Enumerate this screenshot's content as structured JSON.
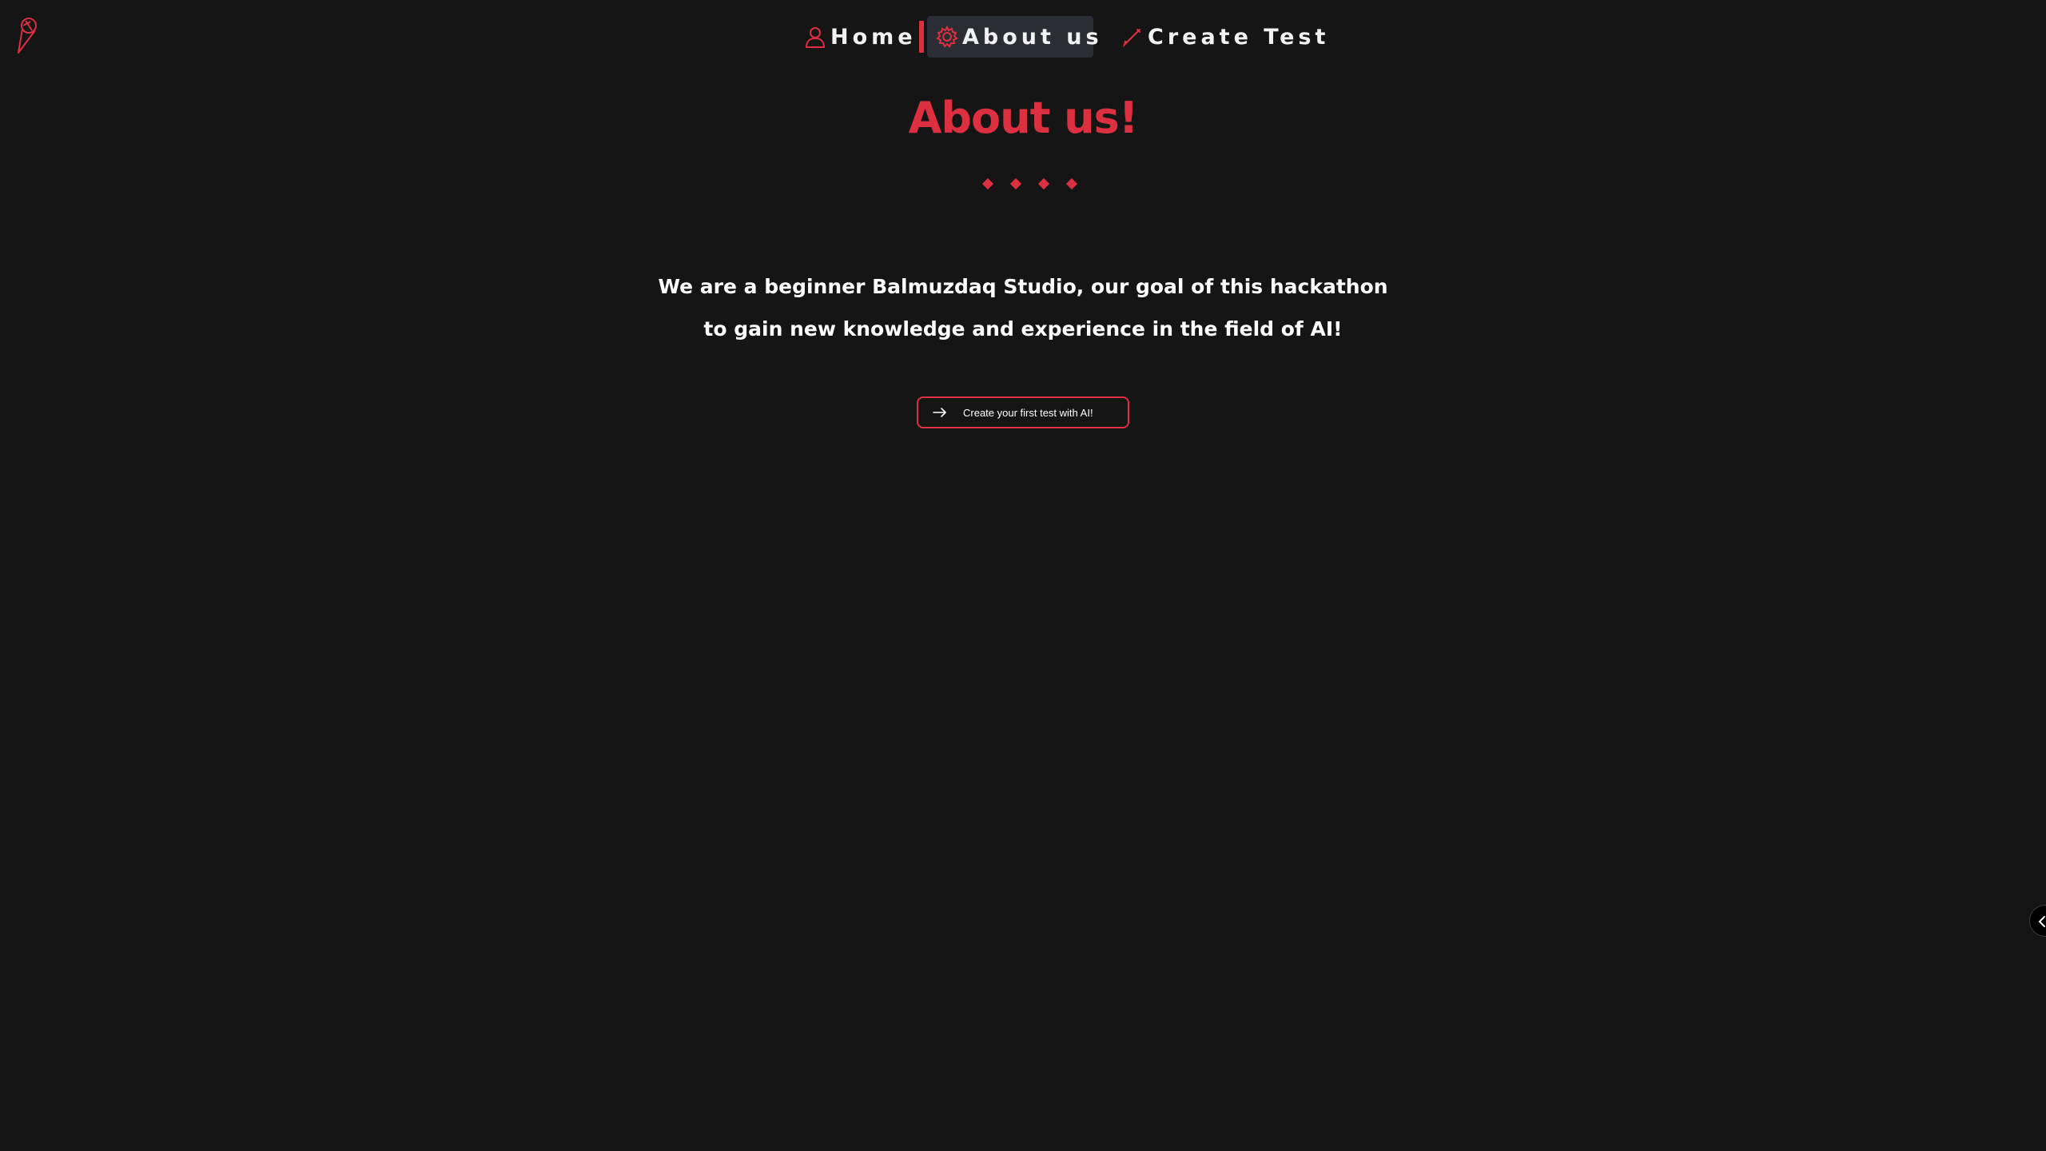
{
  "nav": {
    "items": [
      {
        "label": "Home",
        "icon": "user-icon"
      },
      {
        "label": "About us",
        "icon": "gear-icon",
        "active": true
      },
      {
        "label": "Create Test",
        "icon": "pen-icon"
      }
    ]
  },
  "main": {
    "title": "About us!",
    "intro_line1": "We are a beginner Balmuzdaq Studio, our goal of this hackathon",
    "intro_line2": "to gain new knowledge and experience in the field of AI!",
    "cta_label": "Create your first test with AI!"
  },
  "colors": {
    "background": "#151516",
    "accent": "#dc2f3f",
    "active_tab_bg": "#2a2d33",
    "text": "#ffffff"
  },
  "icons": {
    "logo": "ice-cream-logo-icon",
    "cta": "arrow-right-icon",
    "side_toggle": "chevron-left-icon"
  }
}
